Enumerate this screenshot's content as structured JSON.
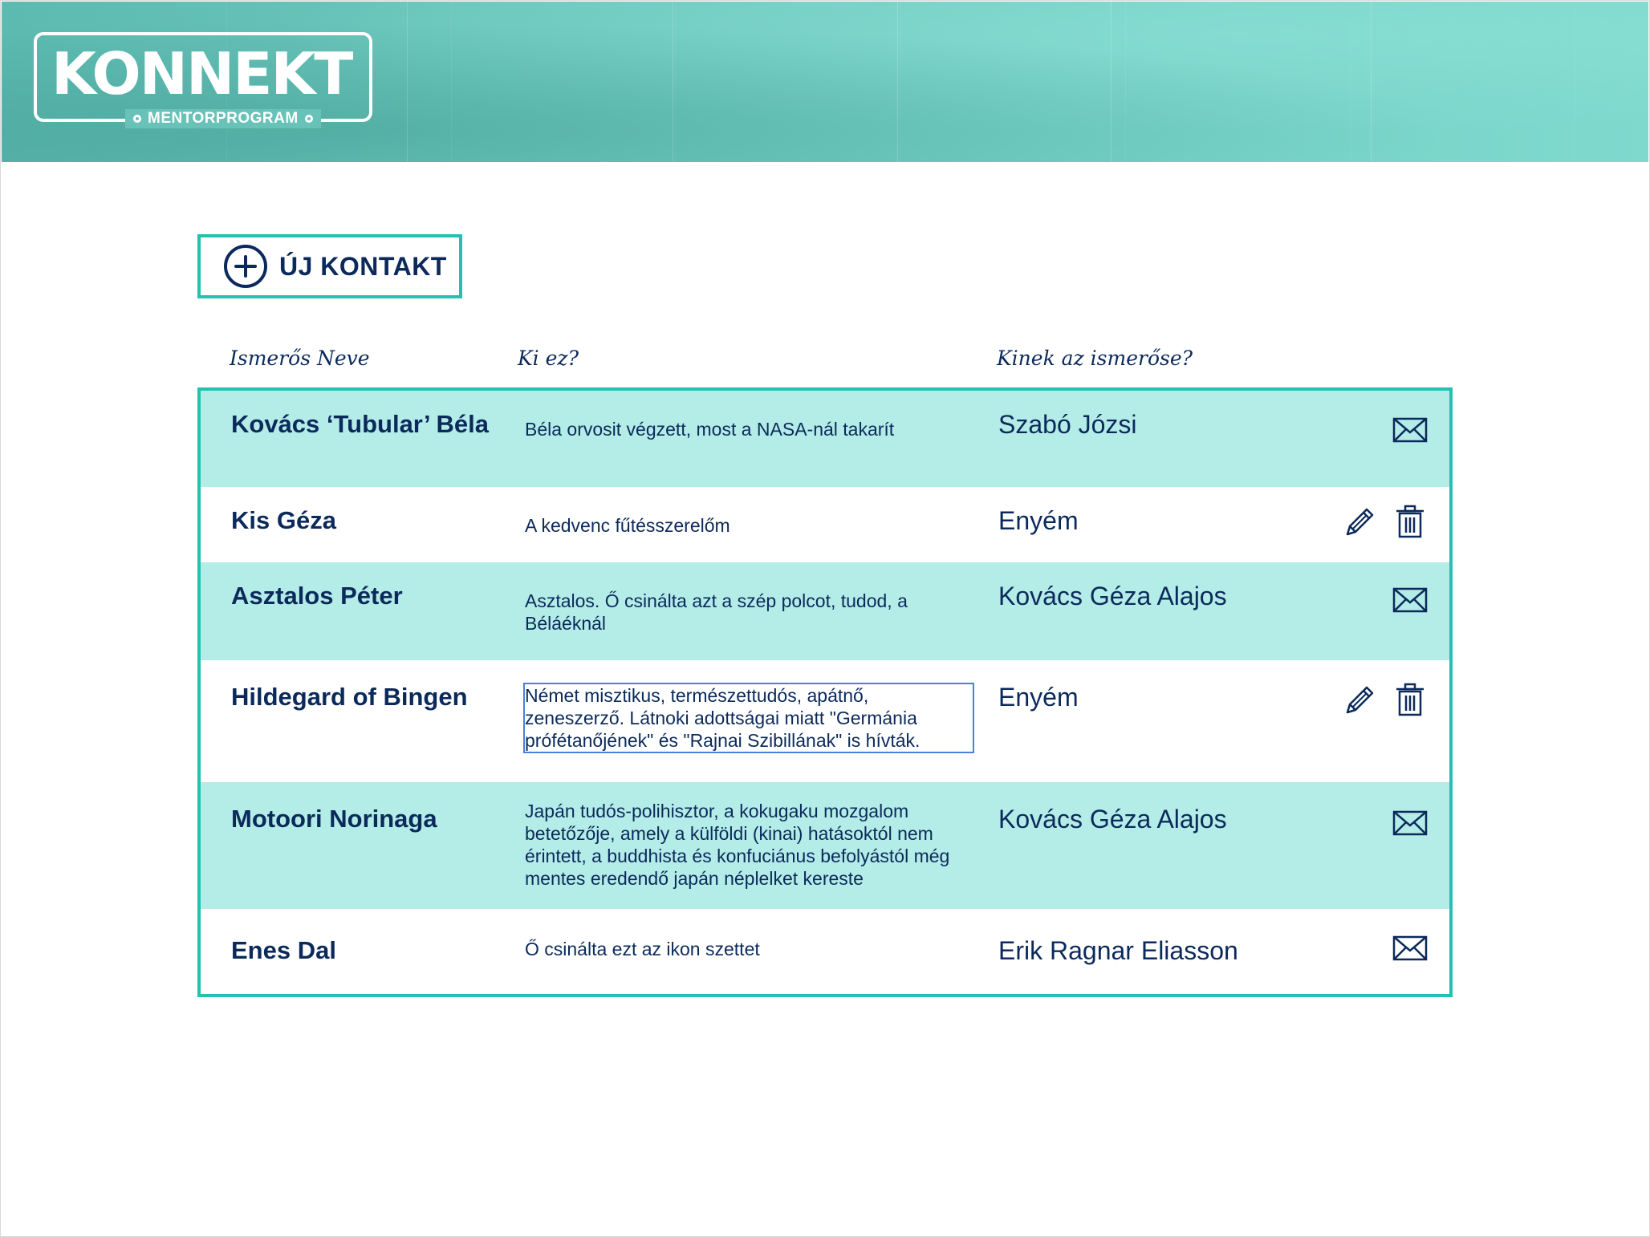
{
  "header": {
    "logo_title": "KONNEKT",
    "logo_subtitle": "MENTORPROGRAM"
  },
  "toolbar": {
    "new_contact_label": "ÚJ KONTAKT"
  },
  "table": {
    "columns": [
      "Ismerős Neve",
      "Ki ez?",
      "Kinek az ismerőse?"
    ],
    "rows": [
      {
        "name": "Kovács ‘Tubular’ Béla",
        "description": "Béla orvosit végzett, most a NASA-nál takarít",
        "owner": "Szabó Józsi",
        "actions": [
          "envelope-icon"
        ]
      },
      {
        "name": "Kis Géza",
        "description": "A kedvenc fűtésszerelőm",
        "owner": "Enyém",
        "actions": [
          "pencil-icon",
          "trash-icon"
        ]
      },
      {
        "name": "Asztalos Péter",
        "description": "Asztalos. Ő csinálta azt a szép polcot, tudod, a Béláéknál",
        "owner": "Kovács Géza Alajos",
        "actions": [
          "envelope-icon"
        ]
      },
      {
        "name": "Hildegard of Bingen",
        "description": "Német misztikus, természettudós, apátnő, zeneszerző. Látnoki adottságai miatt \"Germánia prófétanőjének\" és \"Rajnai Szibillának\" is hívták.",
        "owner": "Enyém",
        "actions": [
          "pencil-icon",
          "trash-icon"
        ]
      },
      {
        "name": "Motoori Norinaga",
        "description": "Japán tudós-polihisztor, a kokugaku mozgalom betetőzője, amely a külföldi (kinai) hatásoktól nem érintett, a buddhista és konfuciánus befolyástól még mentes eredendő japán néplelket kereste",
        "owner": "Kovács Géza Alajos",
        "actions": [
          "envelope-icon"
        ]
      },
      {
        "name": "Enes Dal",
        "description": "Ő csinálta ezt az ikon szettet",
        "owner": "Erik Ragnar Eliasson",
        "actions": [
          "envelope-icon"
        ]
      }
    ]
  },
  "colors": {
    "accent": "#26c0b2",
    "row_tint": "#b4ece7",
    "text": "#0b2a5b",
    "edit_border": "#4a7fe0"
  }
}
